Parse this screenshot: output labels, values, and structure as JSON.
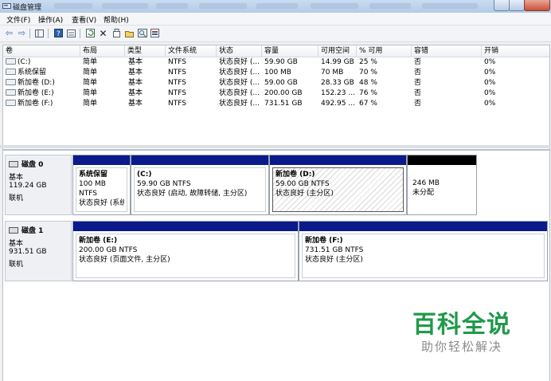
{
  "window": {
    "title": "磁盘管理",
    "accent": "#1f3c8e"
  },
  "menu": [
    "文件(F)",
    "操作(A)",
    "查看(V)",
    "帮助(H)"
  ],
  "toolbar": {
    "icons": [
      "back-arrow-icon",
      "forward-arrow-icon",
      "console-tree-icon",
      "help-icon",
      "list-view-icon",
      "refresh-icon",
      "delete-icon",
      "properties-icon",
      "open-folder-icon",
      "search-icon",
      "disk-settings-icon"
    ]
  },
  "volume_list": {
    "columns": [
      "卷",
      "布局",
      "类型",
      "文件系统",
      "状态",
      "容量",
      "可用空间",
      "% 可用",
      "容错",
      "开销"
    ],
    "rows": [
      [
        "(C:)",
        "简单",
        "基本",
        "NTFS",
        "状态良好 (...",
        "59.90 GB",
        "14.99 GB",
        "25 %",
        "否",
        "0%"
      ],
      [
        "系统保留",
        "简单",
        "基本",
        "NTFS",
        "状态良好 (...",
        "100 MB",
        "70 MB",
        "70 %",
        "否",
        "0%"
      ],
      [
        "新加卷 (D:)",
        "简单",
        "基本",
        "NTFS",
        "状态良好 (...",
        "59.00 GB",
        "28.33 GB",
        "48 %",
        "否",
        "0%"
      ],
      [
        "新加卷 (E:)",
        "简单",
        "基本",
        "NTFS",
        "状态良好 (...",
        "200.00 GB",
        "152.23 ...",
        "76 %",
        "否",
        "0%"
      ],
      [
        "新加卷 (F:)",
        "简单",
        "基本",
        "NTFS",
        "状态良好 (...",
        "731.51 GB",
        "492.95 ...",
        "67 %",
        "否",
        "0%"
      ]
    ]
  },
  "disks": [
    {
      "name": "磁盘 0",
      "type": "基本",
      "size": "119.24 GB",
      "status": "联机",
      "partitions": [
        {
          "name": "系统保留",
          "line1": "100 MB NTFS",
          "line2": "状态良好 (系统,",
          "bar": "#0a1a8a"
        },
        {
          "name": "(C:)",
          "line1": "59.90 GB NTFS",
          "line2": "状态良好 (启动, 故障转储, 主分区)",
          "bar": "#0a1a8a"
        },
        {
          "name": "新加卷  (D:)",
          "line1": "59.00 GB NTFS",
          "line2": "状态良好 (主分区)",
          "bar": "#0a1a8a"
        },
        {
          "name": "",
          "line1": "246 MB",
          "line2": "未分配",
          "bar": "#000000"
        }
      ]
    },
    {
      "name": "磁盘 1",
      "type": "基本",
      "size": "931.51 GB",
      "status": "联机",
      "partitions": [
        {
          "name": "新加卷  (E:)",
          "line1": "200.00 GB NTFS",
          "line2": "状态良好 (页面文件, 主分区)",
          "bar": "#0a1a8a"
        },
        {
          "name": "新加卷  (F:)",
          "line1": "731.51 GB NTFS",
          "line2": "状态良好 (主分区)",
          "bar": "#0a1a8a"
        }
      ]
    }
  ],
  "watermark": {
    "big": "百科全说",
    "small": "助你轻松解决",
    "color": "#1f9a4a"
  }
}
